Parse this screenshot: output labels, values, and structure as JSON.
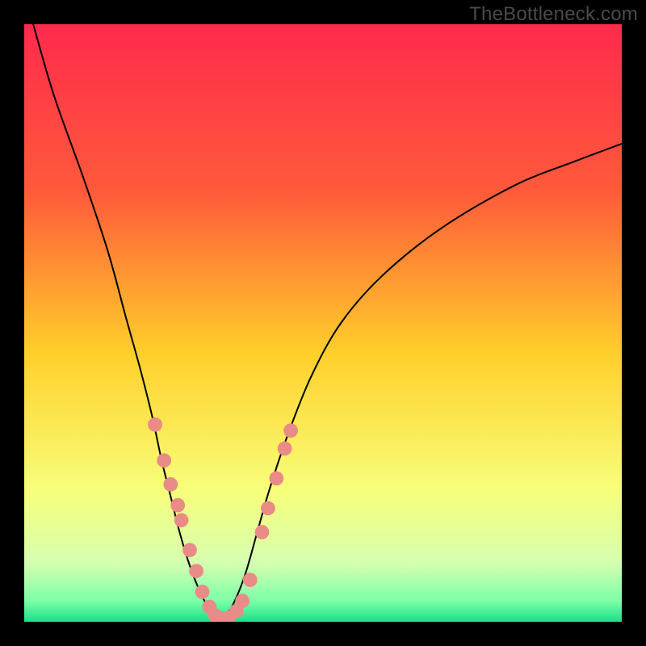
{
  "watermark": "TheBottleneck.com",
  "chart_data": {
    "type": "line",
    "title": "",
    "xlabel": "",
    "ylabel": "",
    "xlim": [
      0,
      100
    ],
    "ylim": [
      0,
      100
    ],
    "grid": false,
    "legend": false,
    "gradient_stops": [
      {
        "offset": 0,
        "color": "#ff2a4d"
      },
      {
        "offset": 0.28,
        "color": "#ff5a3a"
      },
      {
        "offset": 0.55,
        "color": "#ffcf2a"
      },
      {
        "offset": 0.78,
        "color": "#f7ff7a"
      },
      {
        "offset": 0.9,
        "color": "#d7ffb0"
      },
      {
        "offset": 0.965,
        "color": "#7dffa8"
      },
      {
        "offset": 1.0,
        "color": "#18e08a"
      }
    ],
    "series": [
      {
        "name": "left-limb",
        "type": "line",
        "x": [
          1.5,
          5,
          10,
          14,
          17,
          19.5,
          21.5,
          23,
          24.5,
          26,
          27.5,
          29,
          31,
          33
        ],
        "y": [
          100,
          88,
          74,
          62,
          51,
          42,
          34,
          27,
          21,
          15,
          10,
          6,
          2,
          0
        ]
      },
      {
        "name": "right-limb",
        "type": "line",
        "x": [
          33,
          35,
          37,
          39,
          41,
          44,
          48,
          53,
          60,
          70,
          82,
          92,
          100
        ],
        "y": [
          0,
          3,
          8,
          15,
          22,
          31,
          41,
          50,
          58,
          66,
          73,
          77,
          80
        ]
      }
    ],
    "markers": {
      "name": "highlight-dots",
      "color": "#e98b87",
      "radius_pct": 1.2,
      "points": [
        {
          "x": 21.9,
          "y": 33
        },
        {
          "x": 23.4,
          "y": 27
        },
        {
          "x": 24.5,
          "y": 23
        },
        {
          "x": 25.7,
          "y": 19.5
        },
        {
          "x": 26.3,
          "y": 17
        },
        {
          "x": 27.7,
          "y": 12
        },
        {
          "x": 28.8,
          "y": 8.5
        },
        {
          "x": 29.8,
          "y": 5
        },
        {
          "x": 31.0,
          "y": 2.5
        },
        {
          "x": 32.0,
          "y": 1
        },
        {
          "x": 33.0,
          "y": 0.5
        },
        {
          "x": 34.2,
          "y": 0.7
        },
        {
          "x": 35.5,
          "y": 1.8
        },
        {
          "x": 36.5,
          "y": 3.5
        },
        {
          "x": 37.8,
          "y": 7
        },
        {
          "x": 39.8,
          "y": 15
        },
        {
          "x": 40.8,
          "y": 19
        },
        {
          "x": 42.2,
          "y": 24
        },
        {
          "x": 43.6,
          "y": 29
        },
        {
          "x": 44.6,
          "y": 32
        }
      ]
    }
  }
}
